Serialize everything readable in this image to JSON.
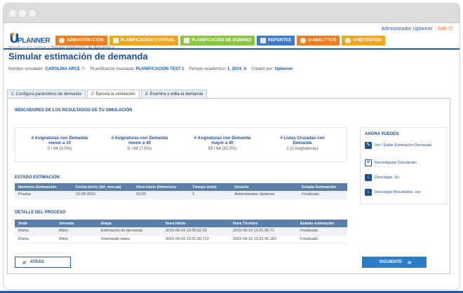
{
  "window": {
    "title": ""
  },
  "user": {
    "name": "Administrador Uplanner",
    "separator": "|",
    "logout": "Salir"
  },
  "logo": {
    "text": "PLANNER",
    "initial": "U"
  },
  "nav": [
    {
      "label": "ADMINISTRACION",
      "color": "#f07c1b"
    },
    {
      "label": "PLANIFICACIÓN CENTRAL",
      "color": "#f1a61f"
    },
    {
      "label": "PLANIFICACIÓN DE DOMINIO",
      "color": "#8cc63e"
    },
    {
      "label": "REPORTES",
      "color": "#3e7bc4"
    },
    {
      "label": "U-ANALYTICS",
      "color": "#f07c1b"
    },
    {
      "label": "U-RETENTION",
      "color": "#f1a61f"
    }
  ],
  "breadcrumb": {
    "root": "Planificación central",
    "sep": " > ",
    "current": "Simular estimación de demanda >"
  },
  "page_title": "Simular estimación de demanda",
  "meta": {
    "sim_label": "Nombre simulador:",
    "sim_value": "CAROLINA ARCE",
    "plan_label": "PLanificación Asociada:",
    "plan_value": "PLANIFICACIÓN TEST 1",
    "period_label": "Periodo académico:",
    "period_value": "1_2014_A",
    "creator_label": "Creado por:",
    "creator_value": "Uplanner"
  },
  "tabs": [
    {
      "label": "1. Configura parámetros de demanda",
      "active": false
    },
    {
      "label": "2. Ejecuta la simulación",
      "active": true
    },
    {
      "label": "3. Examina y edita la demanda",
      "active": false
    }
  ],
  "indicators": {
    "title": "INDICADORES DE LOS RESULTADOS DE TU SIMULACIÓN",
    "items": [
      {
        "label1": "# Asignaturas con Demanda",
        "label2": "menor a 10",
        "value": "0 / 64 (0,0%)"
      },
      {
        "label1": "# Asignaturas con Demanda",
        "label2": "menor a 40",
        "value": "5 / 64 (7,8%)"
      },
      {
        "label1": "# Asignaturas con Demanda",
        "label2": "mayor a 40",
        "value": "59 / 64 (92,2%)"
      },
      {
        "label1": "# Listas Cruzadas con",
        "label2": "Demanda",
        "value": "1 (2 Asignaturas)"
      }
    ]
  },
  "ahora": {
    "title": "AHORA PUEDES:",
    "actions": [
      {
        "label": "Ver / Editar Estimación Demanda",
        "icon": "pencil-icon"
      },
      {
        "label": "Reconfigurar Simulación",
        "icon": "tools-icon"
      },
      {
        "label": "Descargar .xls",
        "icon": "download-icon"
      },
      {
        "label": "Descargar Resultados .csv",
        "icon": "download-icon"
      }
    ]
  },
  "estado": {
    "title": "ESTADO ESTIMACIÓN",
    "headers": [
      "Nombres Estimación",
      "Fecha Inicio (dd_mm-aa)",
      "Hora Inicio (hh/mm/ss",
      "Tiempo (min)",
      "Usuario",
      "Estado Estimación"
    ],
    "rows": [
      [
        "Prueba",
        "10-09-2015",
        "13:30",
        "1",
        "Administrador Uplanner",
        "Finalizado"
      ]
    ]
  },
  "detalle": {
    "title": "DETALLE DEL PROCESO",
    "headers": [
      "Sede",
      "Jornada",
      "Etapa",
      "Hora Inicio",
      "Hora Término",
      "Estado estimación"
    ],
    "rows": [
      [
        "Roma",
        "Mixto",
        "Estimación de demanda",
        "2015-09-10 13:30:52.53",
        "2015-09-10 13:31:30.71",
        "Finalizado"
      ],
      [
        "Roma",
        "Mixto",
        "Insertando datos",
        "2015-09-10 13:31:30.713",
        "2015-09-10 13:31:36.183",
        "Finalizado"
      ]
    ]
  },
  "buttons": {
    "back": "ATRÁS",
    "next": "SIGUIENTE"
  },
  "colors": {
    "brand": "#1f5aa6",
    "accent": "#f07c1b",
    "table_header": "#5b7ea8"
  }
}
